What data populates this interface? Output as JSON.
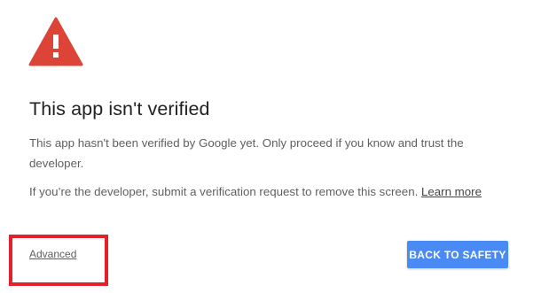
{
  "title": "This app isn't verified",
  "paragraph1": "This app hasn't been verified by Google yet. Only proceed if you know and trust the developer.",
  "paragraph2": "If you’re the developer, submit a verification request to remove this screen. ",
  "learn_more": "Learn more",
  "advanced": "Advanced",
  "back_button": "BACK TO SAFETY",
  "colors": {
    "warning": "#db4437",
    "button": "#4a8af4",
    "highlight": "#e5202a"
  },
  "icons": {
    "warning": "warning-triangle-icon"
  }
}
